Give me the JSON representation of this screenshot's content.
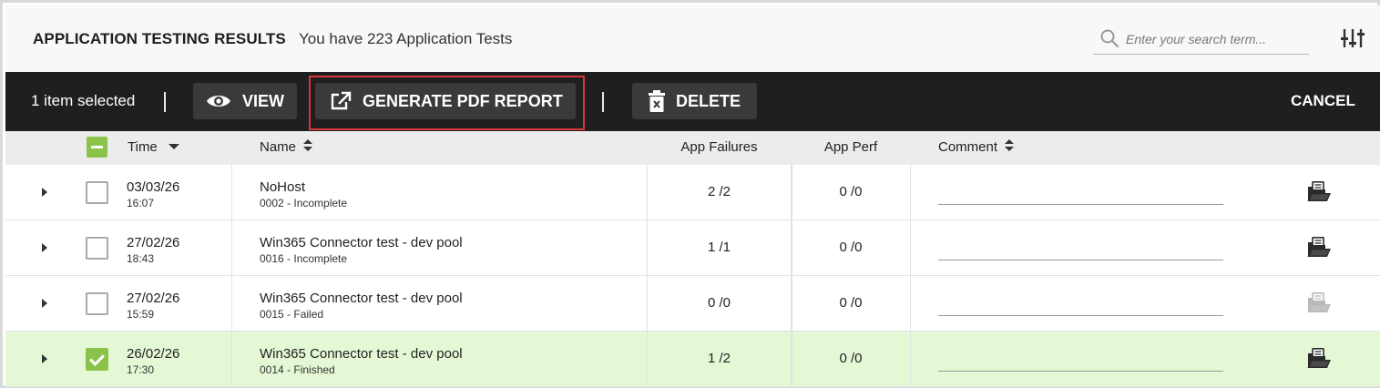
{
  "header": {
    "title": "APPLICATION TESTING RESULTS",
    "subtitle": "You have 223 Application Tests",
    "search_placeholder": "Enter your search term..."
  },
  "actionbar": {
    "selected_text": "1 item selected",
    "view_label": "VIEW",
    "pdf_label": "GENERATE PDF REPORT",
    "delete_label": "DELETE",
    "cancel_label": "CANCEL"
  },
  "columns": {
    "time": "Time",
    "name": "Name",
    "app_failures": "App Failures",
    "app_perf": "App Perf",
    "comment": "Comment"
  },
  "rows": [
    {
      "date": "03/03/26",
      "time": "16:07",
      "name": "NoHost",
      "status": "0002 - Incomplete",
      "app_failures": "2 /2",
      "app_perf": "0 /0",
      "comment": "",
      "selected": false,
      "report_enabled": true
    },
    {
      "date": "27/02/26",
      "time": "18:43",
      "name": "Win365 Connector test - dev pool",
      "status": "0016 - Incomplete",
      "app_failures": "1 /1",
      "app_perf": "0 /0",
      "comment": "",
      "selected": false,
      "report_enabled": true
    },
    {
      "date": "27/02/26",
      "time": "15:59",
      "name": "Win365 Connector test - dev pool",
      "status": "0015 - Failed",
      "app_failures": "0 /0",
      "app_perf": "0 /0",
      "comment": "",
      "selected": false,
      "report_enabled": false
    },
    {
      "date": "26/02/26",
      "time": "17:30",
      "name": "Win365 Connector test - dev pool",
      "status": "0014 - Finished",
      "app_failures": "1 /2",
      "app_perf": "0 /0",
      "comment": "",
      "selected": true,
      "report_enabled": true
    }
  ],
  "colors": {
    "accent_green": "#8bc34a",
    "selected_row": "#e5f8d5",
    "actionbar_bg": "#1f1f1f",
    "highlight_red": "#d9363e"
  },
  "icons": {
    "search": "search-icon",
    "filter": "sliders-icon",
    "view": "eye-icon",
    "pdf": "external-link-icon",
    "delete": "trash-icon",
    "report": "folder-report-icon",
    "expand": "caret-right-icon"
  }
}
